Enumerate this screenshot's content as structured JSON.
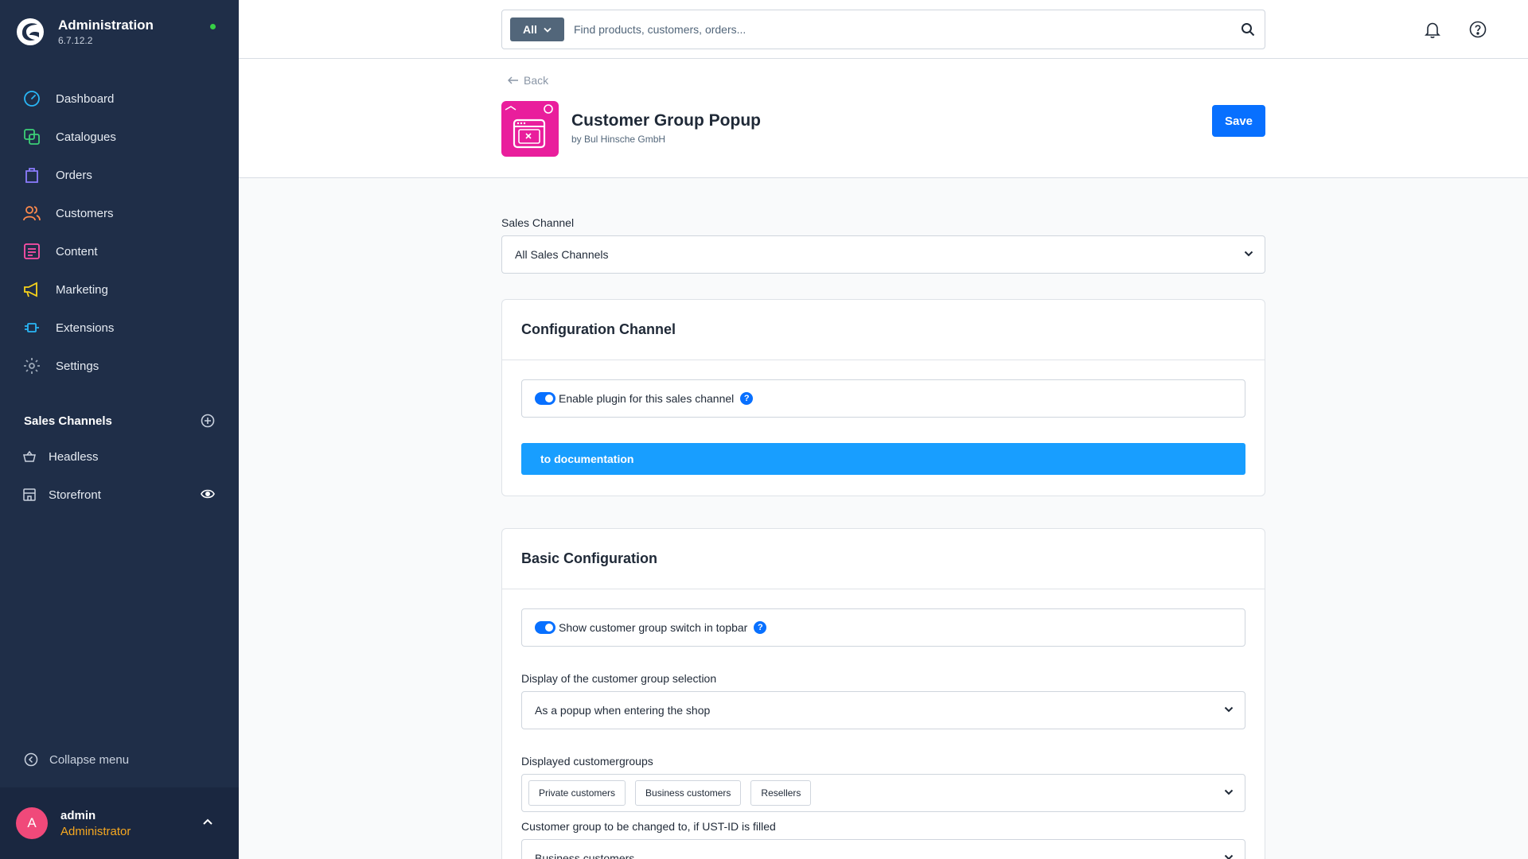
{
  "app": {
    "title": "Administration",
    "version": "6.7.12.2",
    "status_color": "#37d046"
  },
  "nav": {
    "items": [
      {
        "label": "Dashboard",
        "icon": "dashboard-icon",
        "color": "#29b6f6"
      },
      {
        "label": "Catalogues",
        "icon": "catalogue-icon",
        "color": "#3ccf77"
      },
      {
        "label": "Orders",
        "icon": "orders-bag-icon",
        "color": "#8c7cff"
      },
      {
        "label": "Customers",
        "icon": "customers-icon",
        "color": "#ff8a4c"
      },
      {
        "label": "Content",
        "icon": "content-icon",
        "color": "#ff4fa7"
      },
      {
        "label": "Marketing",
        "icon": "marketing-megaphone-icon",
        "color": "#f7d21b"
      },
      {
        "label": "Extensions",
        "icon": "extensions-plug-icon",
        "color": "#29b6f6"
      },
      {
        "label": "Settings",
        "icon": "settings-gear-icon",
        "color": "#9aa6b6"
      }
    ]
  },
  "sales_channels": {
    "title": "Sales Channels",
    "items": [
      {
        "label": "Headless"
      },
      {
        "label": "Storefront"
      }
    ]
  },
  "sidebar_footer": {
    "collapse_label": "Collapse menu"
  },
  "user": {
    "initial": "A",
    "name": "admin",
    "role": "Administrator"
  },
  "search": {
    "type_label": "All",
    "placeholder": "Find products, customers, orders..."
  },
  "header": {
    "back_label": "Back",
    "plugin_title": "Customer Group Popup",
    "plugin_vendor": "by Bul Hinsche GmbH",
    "save_label": "Save",
    "accent_color": "#0870ff"
  },
  "sales_channel": {
    "label": "Sales Channel",
    "value": "All Sales Channels"
  },
  "config_channel": {
    "title": "Configuration Channel",
    "enable_label": "Enable plugin for this sales channel",
    "enable_value": true,
    "help": "?",
    "doc_button": "to documentation"
  },
  "basic_config": {
    "title": "Basic Configuration",
    "topbar_switch_label": "Show customer group switch in topbar",
    "topbar_switch_value": true,
    "help": "?",
    "display_label": "Display of the customer group selection",
    "display_value": "As a popup when entering the shop",
    "groups_label": "Displayed customergroups",
    "groups": [
      "Private customers",
      "Business customers",
      "Resellers"
    ],
    "ustid_label": "Customer group to be changed to, if UST-ID is filled",
    "ustid_value": "Business customers"
  }
}
